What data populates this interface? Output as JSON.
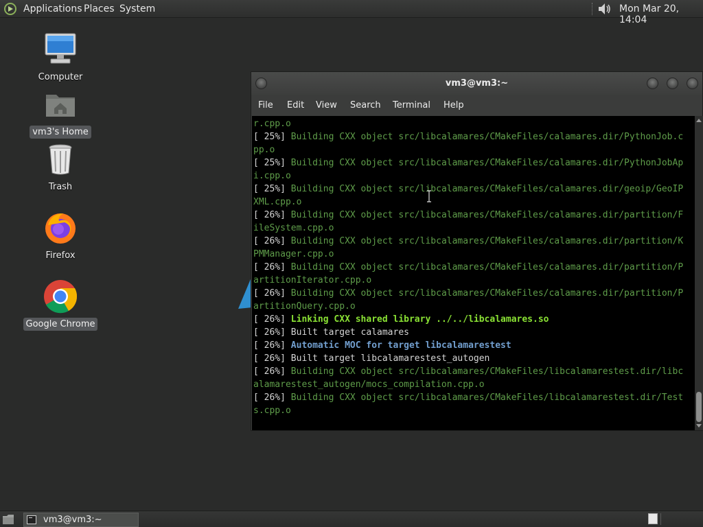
{
  "top_panel": {
    "menus": [
      "Applications",
      "Places",
      "System"
    ],
    "clock": "Mon Mar 20, 14:04"
  },
  "desktop": {
    "icons": [
      {
        "label": "Computer",
        "icon": "computer-icon"
      },
      {
        "label": "vm3's Home",
        "icon": "home-folder-icon"
      },
      {
        "label": "Trash",
        "icon": "trash-icon"
      },
      {
        "label": "Firefox",
        "icon": "firefox-icon"
      },
      {
        "label": "Google Chrome",
        "icon": "chrome-icon"
      }
    ]
  },
  "terminal": {
    "title": "vm3@vm3:~",
    "menu": [
      "File",
      "Edit",
      "View",
      "Search",
      "Terminal",
      "Help"
    ],
    "lines": [
      {
        "prefix": "",
        "text": "r.cpp.o",
        "style": "build"
      },
      {
        "prefix": "[ 25%] ",
        "text": "Building CXX object src/libcalamares/CMakeFiles/calamares.dir/PythonJob.c",
        "style": "build"
      },
      {
        "prefix": "",
        "text": "pp.o",
        "style": "build"
      },
      {
        "prefix": "[ 25%] ",
        "text": "Building CXX object src/libcalamares/CMakeFiles/calamares.dir/PythonJobAp",
        "style": "build"
      },
      {
        "prefix": "",
        "text": "i.cpp.o",
        "style": "build"
      },
      {
        "prefix": "[ 25%] ",
        "text": "Building CXX object src/libcalamares/CMakeFiles/calamares.dir/geoip/GeoIP",
        "style": "build"
      },
      {
        "prefix": "",
        "text": "XML.cpp.o",
        "style": "build"
      },
      {
        "prefix": "[ 26%] ",
        "text": "Building CXX object src/libcalamares/CMakeFiles/calamares.dir/partition/F",
        "style": "build"
      },
      {
        "prefix": "",
        "text": "ileSystem.cpp.o",
        "style": "build"
      },
      {
        "prefix": "[ 26%] ",
        "text": "Building CXX object src/libcalamares/CMakeFiles/calamares.dir/partition/K",
        "style": "build"
      },
      {
        "prefix": "",
        "text": "PMManager.cpp.o",
        "style": "build"
      },
      {
        "prefix": "[ 26%] ",
        "text": "Building CXX object src/libcalamares/CMakeFiles/calamares.dir/partition/P",
        "style": "build"
      },
      {
        "prefix": "",
        "text": "artitionIterator.cpp.o",
        "style": "build"
      },
      {
        "prefix": "[ 26%] ",
        "text": "Building CXX object src/libcalamares/CMakeFiles/calamares.dir/partition/P",
        "style": "build"
      },
      {
        "prefix": "",
        "text": "artitionQuery.cpp.o",
        "style": "build"
      },
      {
        "prefix": "[ 26%] ",
        "text": "Linking CXX shared library ../../libcalamares.so",
        "style": "link"
      },
      {
        "prefix": "[ 26%] ",
        "text": "Built target calamares",
        "style": "plain"
      },
      {
        "prefix": "[ 26%] ",
        "text": "Automatic MOC for target libcalamarestest",
        "style": "moc"
      },
      {
        "prefix": "[ 26%] ",
        "text": "Built target libcalamarestest_autogen",
        "style": "plain"
      },
      {
        "prefix": "[ 26%] ",
        "text": "Building CXX object src/libcalamares/CMakeFiles/libcalamarestest.dir/libc",
        "style": "build"
      },
      {
        "prefix": "",
        "text": "alamarestest_autogen/mocs_compilation.cpp.o",
        "style": "build"
      },
      {
        "prefix": "[ 26%] ",
        "text": "Building CXX object src/libcalamares/CMakeFiles/libcalamarestest.dir/Test",
        "style": "build"
      },
      {
        "prefix": "",
        "text": "s.cpp.o",
        "style": "build"
      }
    ]
  },
  "taskbar": {
    "window_button": "vm3@vm3:~"
  }
}
